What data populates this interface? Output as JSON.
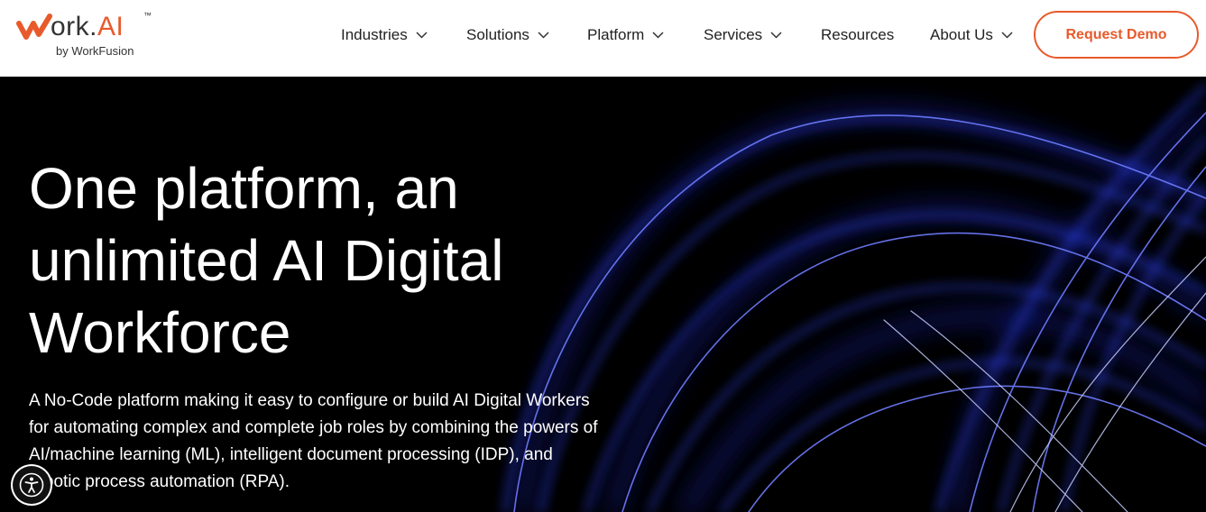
{
  "brand": {
    "logo_text": "ork.",
    "logo_accent": "AI",
    "trademark": "™",
    "byline": "by WorkFusion",
    "accent_color": "#e85a2b"
  },
  "nav": {
    "items": [
      {
        "label": "Industries",
        "has_dropdown": true,
        "icon": "chevron-down-icon"
      },
      {
        "label": "Solutions",
        "has_dropdown": true,
        "icon": "chevron-down-icon"
      },
      {
        "label": "Platform",
        "has_dropdown": true,
        "icon": "chevron-down-icon"
      },
      {
        "label": "Services",
        "has_dropdown": true,
        "icon": "chevron-down-icon"
      },
      {
        "label": "Resources",
        "has_dropdown": false
      },
      {
        "label": "About Us",
        "has_dropdown": true,
        "icon": "chevron-down-icon"
      }
    ],
    "cta_label": "Request Demo"
  },
  "hero": {
    "title": "One platform, an unlimited AI Digital Workforce",
    "description": "A No-Code platform making it easy to configure or build AI Digital Workers for automating complex and complete job roles by combining the powers of AI/machine learning (ML), intelligent document processing (IDP), and robotic process automation (RPA).",
    "background_color": "#000000",
    "art_color": "#2a3cff"
  },
  "accessibility": {
    "icon": "accessibility-icon"
  }
}
